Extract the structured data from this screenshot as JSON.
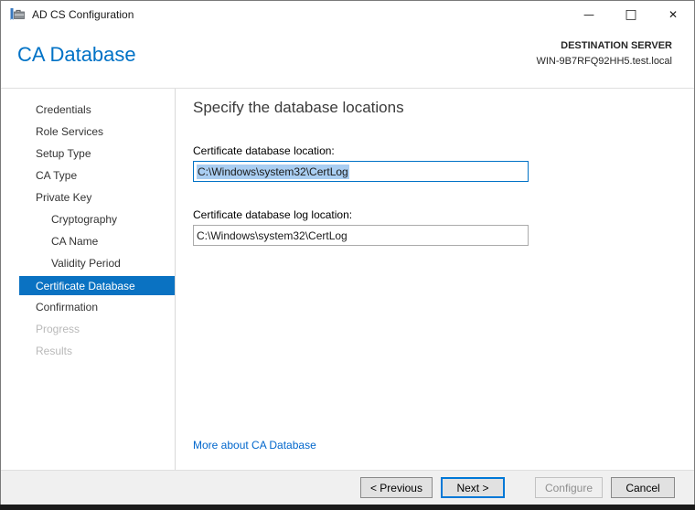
{
  "window": {
    "title": "AD CS Configuration",
    "controls": {
      "minimize": "—",
      "maximize": "□",
      "close": "✕"
    }
  },
  "header": {
    "page_title": "CA Database",
    "destination_label": "DESTINATION SERVER",
    "destination_server": "WIN-9B7RFQ92HH5.test.local"
  },
  "sidebar": {
    "items": [
      {
        "label": "Credentials",
        "level": 1,
        "state": "enabled"
      },
      {
        "label": "Role Services",
        "level": 1,
        "state": "enabled"
      },
      {
        "label": "Setup Type",
        "level": 1,
        "state": "enabled"
      },
      {
        "label": "CA Type",
        "level": 1,
        "state": "enabled"
      },
      {
        "label": "Private Key",
        "level": 1,
        "state": "enabled"
      },
      {
        "label": "Cryptography",
        "level": 2,
        "state": "enabled"
      },
      {
        "label": "CA Name",
        "level": 2,
        "state": "enabled"
      },
      {
        "label": "Validity Period",
        "level": 2,
        "state": "enabled"
      },
      {
        "label": "Certificate Database",
        "level": 1,
        "state": "selected"
      },
      {
        "label": "Confirmation",
        "level": 1,
        "state": "enabled"
      },
      {
        "label": "Progress",
        "level": 1,
        "state": "disabled"
      },
      {
        "label": "Results",
        "level": 1,
        "state": "disabled"
      }
    ]
  },
  "content": {
    "heading": "Specify the database locations",
    "fields": [
      {
        "label": "Certificate database location:",
        "value": "C:\\Windows\\system32\\CertLog",
        "focused": true,
        "text_selected": true
      },
      {
        "label": "Certificate database log location:",
        "value": "C:\\Windows\\system32\\CertLog",
        "focused": false,
        "text_selected": false
      }
    ],
    "link": "More about CA Database"
  },
  "footer": {
    "buttons": [
      {
        "label": "< Previous",
        "state": "enabled"
      },
      {
        "label": "Next >",
        "state": "default"
      },
      {
        "label": "Configure",
        "state": "disabled"
      },
      {
        "label": "Cancel",
        "state": "enabled"
      }
    ]
  },
  "colors": {
    "accent_blue": "#0072C6",
    "nav_selected_bg": "#0A72C2",
    "link_blue": "#0066CC",
    "text_selection_highlight": "#A9CDF1",
    "footer_bg": "#F0F0F0",
    "next_button_border": "#0078D7"
  }
}
